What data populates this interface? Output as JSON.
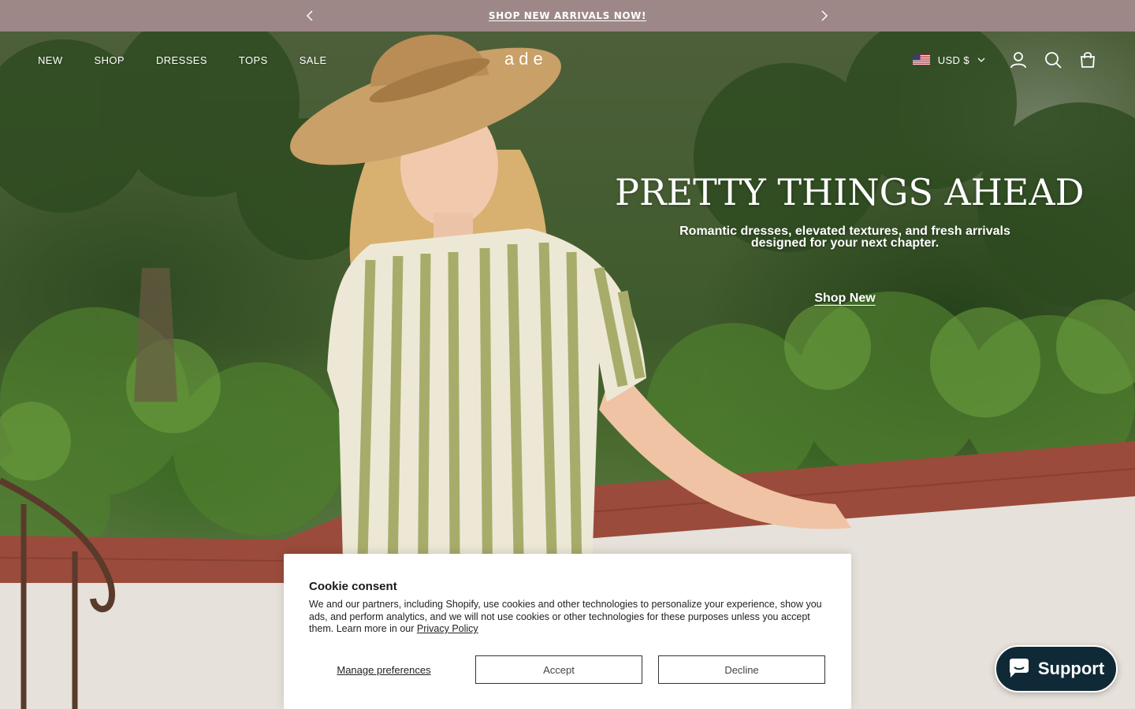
{
  "announcement": {
    "text": "SHOP NEW ARRIVALS NOW!",
    "prev_icon": "chevron-left-icon",
    "next_icon": "chevron-right-icon"
  },
  "header": {
    "nav": [
      "NEW",
      "SHOP",
      "DRESSES",
      "TOPS",
      "SALE"
    ],
    "logo": "ade",
    "currency": "USD $",
    "icons": [
      "us-flag-icon",
      "chevron-down-icon",
      "account-icon",
      "search-icon",
      "cart-icon"
    ]
  },
  "hero": {
    "title": "PRETTY THINGS AHEAD",
    "subtitle_line1": "Romantic dresses, elevated textures, and fresh arrivals",
    "subtitle_line2": "designed for your next chapter.",
    "cta": "Shop New"
  },
  "cookie": {
    "title": "Cookie consent",
    "body": "We and our partners, including Shopify, use cookies and other technologies to personalize your experience, show you ads, and perform analytics, and we will not use cookies or other technologies for these purposes unless you accept them. Learn more in our ",
    "link": "Privacy Policy",
    "manage": "Manage preferences",
    "accept": "Accept",
    "decline": "Decline"
  },
  "support": {
    "label": "Support",
    "icon": "chat-bubble-icon"
  },
  "colors": {
    "announcement_bg": "#9d8787",
    "support_bg": "#0f2a36"
  }
}
